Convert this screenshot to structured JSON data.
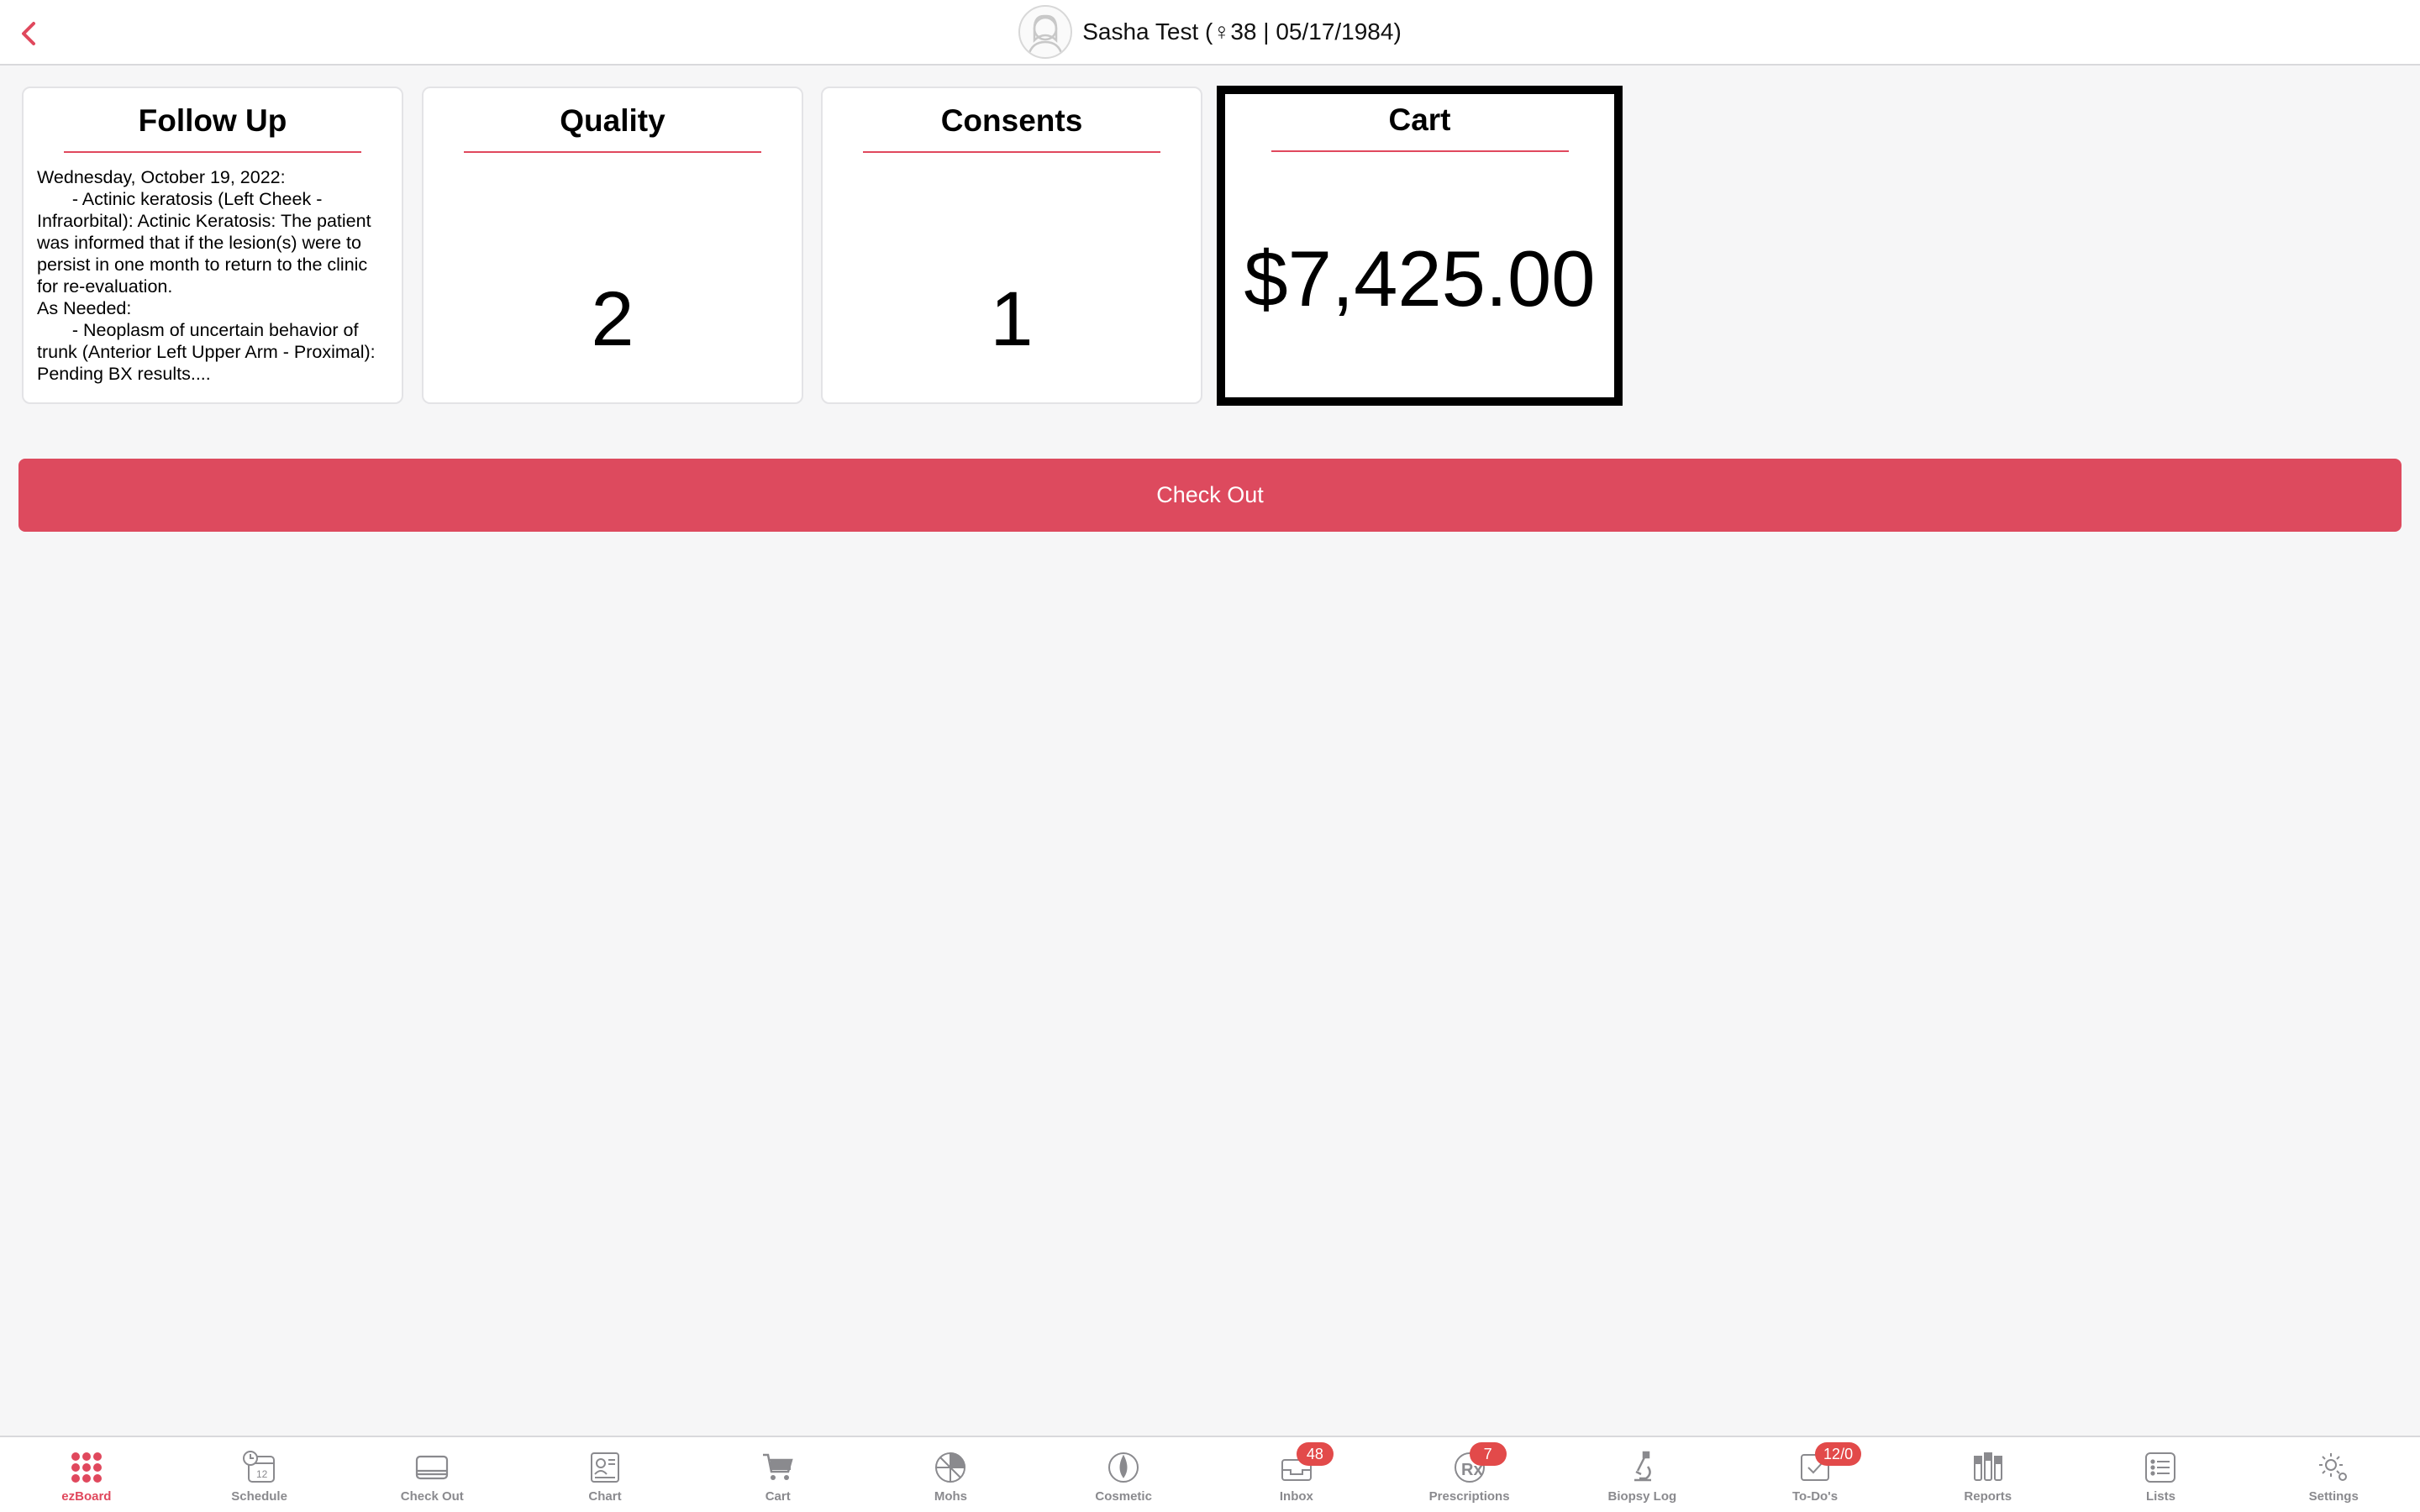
{
  "header": {
    "patient_label": "Sasha Test (♀38 | 05/17/1984)"
  },
  "cards": {
    "follow_up": {
      "title": "Follow Up",
      "text": "Wednesday, October 19, 2022:\n       - Actinic keratosis (Left Cheek - Infraorbital): Actinic Keratosis: The patient was informed that if the lesion(s) were to persist in one month to return to the clinic for re-evaluation.\nAs Needed:\n       - Neoplasm of uncertain behavior of trunk (Anterior Left Upper Arm - Proximal): Pending BX results...."
    },
    "quality": {
      "title": "Quality",
      "value": "2"
    },
    "consents": {
      "title": "Consents",
      "value": "1"
    },
    "cart": {
      "title": "Cart",
      "value": "$7,425.00"
    }
  },
  "actions": {
    "checkout_label": "Check Out"
  },
  "colors": {
    "accent": "#e0485d",
    "button": "#dd4a5e",
    "badge": "#e24a4a"
  },
  "tabs": [
    {
      "label": "ezBoard",
      "icon": "grid-dots-icon",
      "active": true
    },
    {
      "label": "Schedule",
      "icon": "calendar-clock-icon"
    },
    {
      "label": "Check Out",
      "icon": "card-icon"
    },
    {
      "label": "Chart",
      "icon": "chart-id-icon"
    },
    {
      "label": "Cart",
      "icon": "cart-icon"
    },
    {
      "label": "Mohs",
      "icon": "mohs-circle-icon"
    },
    {
      "label": "Cosmetic",
      "icon": "cosmetic-drop-icon"
    },
    {
      "label": "Inbox",
      "icon": "inbox-icon",
      "badge": "48"
    },
    {
      "label": "Prescriptions",
      "icon": "rx-icon",
      "badge": "7"
    },
    {
      "label": "Biopsy Log",
      "icon": "microscope-icon"
    },
    {
      "label": "To-Do's",
      "icon": "todo-check-icon",
      "badge": "12/0"
    },
    {
      "label": "Reports",
      "icon": "reports-bars-icon"
    },
    {
      "label": "Lists",
      "icon": "list-icon"
    },
    {
      "label": "Settings",
      "icon": "gear-icon"
    }
  ]
}
